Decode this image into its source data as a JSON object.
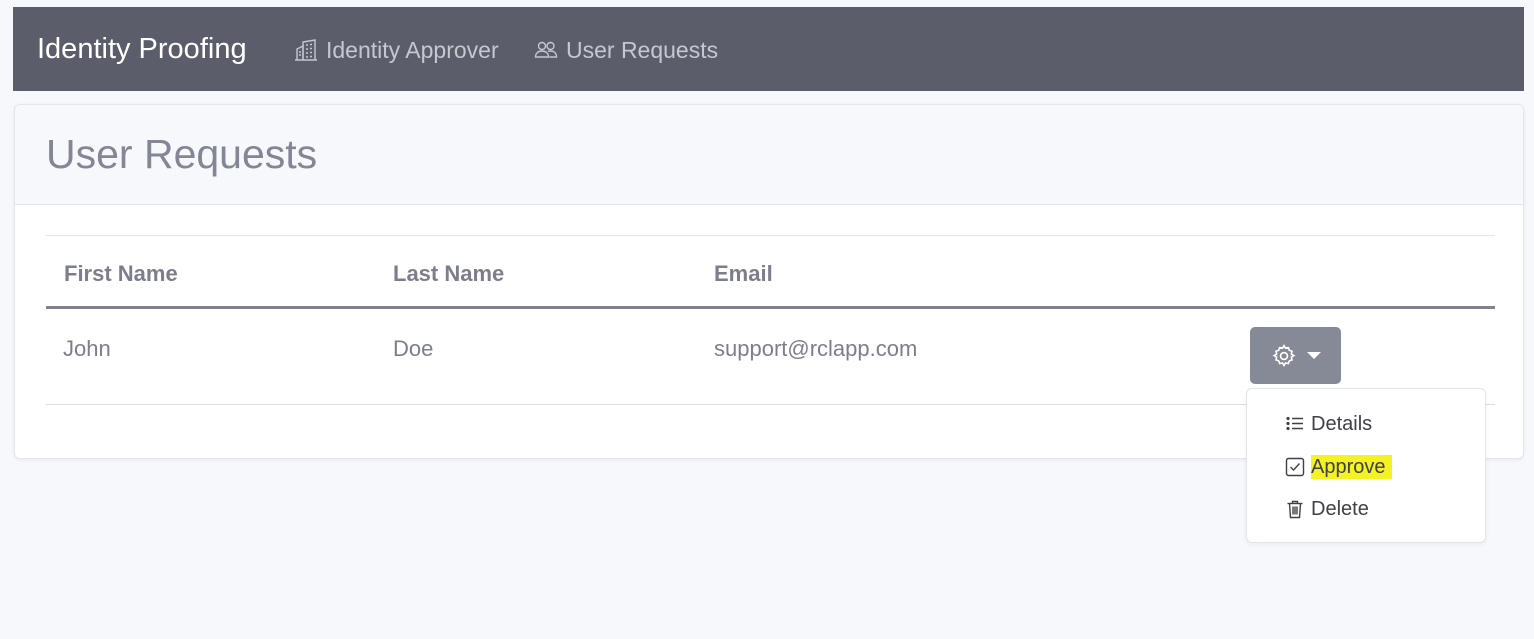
{
  "navbar": {
    "brand": "Identity Proofing",
    "links": [
      {
        "label": "Identity Approver",
        "icon": "building-icon"
      },
      {
        "label": "User Requests",
        "icon": "people-icon"
      }
    ]
  },
  "page": {
    "title": "User Requests"
  },
  "table": {
    "headers": [
      "First Name",
      "Last Name",
      "Email"
    ],
    "rows": [
      {
        "first_name": "John",
        "last_name": "Doe",
        "email": "support@rclapp.com"
      }
    ]
  },
  "actions_menu": {
    "button_icon": "gear-icon",
    "items": [
      {
        "label": "Details",
        "icon": "list-icon"
      },
      {
        "label": "Approve",
        "icon": "check-square-icon",
        "highlighted": true
      },
      {
        "label": "Delete",
        "icon": "trash-icon"
      }
    ]
  },
  "colors": {
    "navbar_bg": "#5b5d6b",
    "button_bg": "#868996",
    "highlight": "#f5f223"
  }
}
